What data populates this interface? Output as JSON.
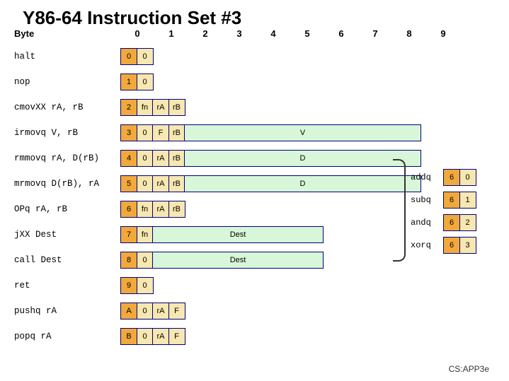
{
  "title": "Y86-64 Instruction Set #3",
  "byte_label": "Byte",
  "byte_cols": [
    "0",
    "1",
    "2",
    "3",
    "4",
    "5",
    "6",
    "7",
    "8",
    "9"
  ],
  "rows": [
    {
      "mnemonic": "halt",
      "cells": [
        "0",
        "0"
      ]
    },
    {
      "mnemonic": "nop",
      "cells": [
        "1",
        "0"
      ]
    },
    {
      "mnemonic": "cmovXX rA, rB",
      "cells": [
        "2",
        "fn",
        "rA",
        "rB"
      ]
    },
    {
      "mnemonic": "irmovq V, rB",
      "cells": [
        "3",
        "0",
        "F",
        "rB"
      ],
      "wide": "V",
      "wclass": "w-v"
    },
    {
      "mnemonic": "rmmovq rA, D(rB)",
      "cells": [
        "4",
        "0",
        "rA",
        "rB"
      ],
      "wide": "D",
      "wclass": "w-v"
    },
    {
      "mnemonic": "mrmovq D(rB), rA",
      "cells": [
        "5",
        "0",
        "rA",
        "rB"
      ],
      "wide": "D",
      "wclass": "w-v"
    },
    {
      "mnemonic": "OPq rA, rB",
      "cells": [
        "6",
        "fn",
        "rA",
        "rB"
      ]
    },
    {
      "mnemonic": "jXX Dest",
      "cells": [
        "7",
        "fn"
      ],
      "wide": "Dest",
      "wclass": "w-dest"
    },
    {
      "mnemonic": "call Dest",
      "cells": [
        "8",
        "0"
      ],
      "wide": "Dest",
      "wclass": "w-dest"
    },
    {
      "mnemonic": "ret",
      "cells": [
        "9",
        "0"
      ]
    },
    {
      "mnemonic": "pushq rA",
      "cells": [
        "A",
        "0",
        "rA",
        "F"
      ]
    },
    {
      "mnemonic": "popq rA",
      "cells": [
        "B",
        "0",
        "rA",
        "F"
      ]
    }
  ],
  "ops": [
    {
      "name": "addq",
      "cells": [
        "6",
        "0"
      ]
    },
    {
      "name": "subq",
      "cells": [
        "6",
        "1"
      ]
    },
    {
      "name": "andq",
      "cells": [
        "6",
        "2"
      ]
    },
    {
      "name": "xorq",
      "cells": [
        "6",
        "3"
      ]
    }
  ],
  "footer": "CS:APP3e"
}
